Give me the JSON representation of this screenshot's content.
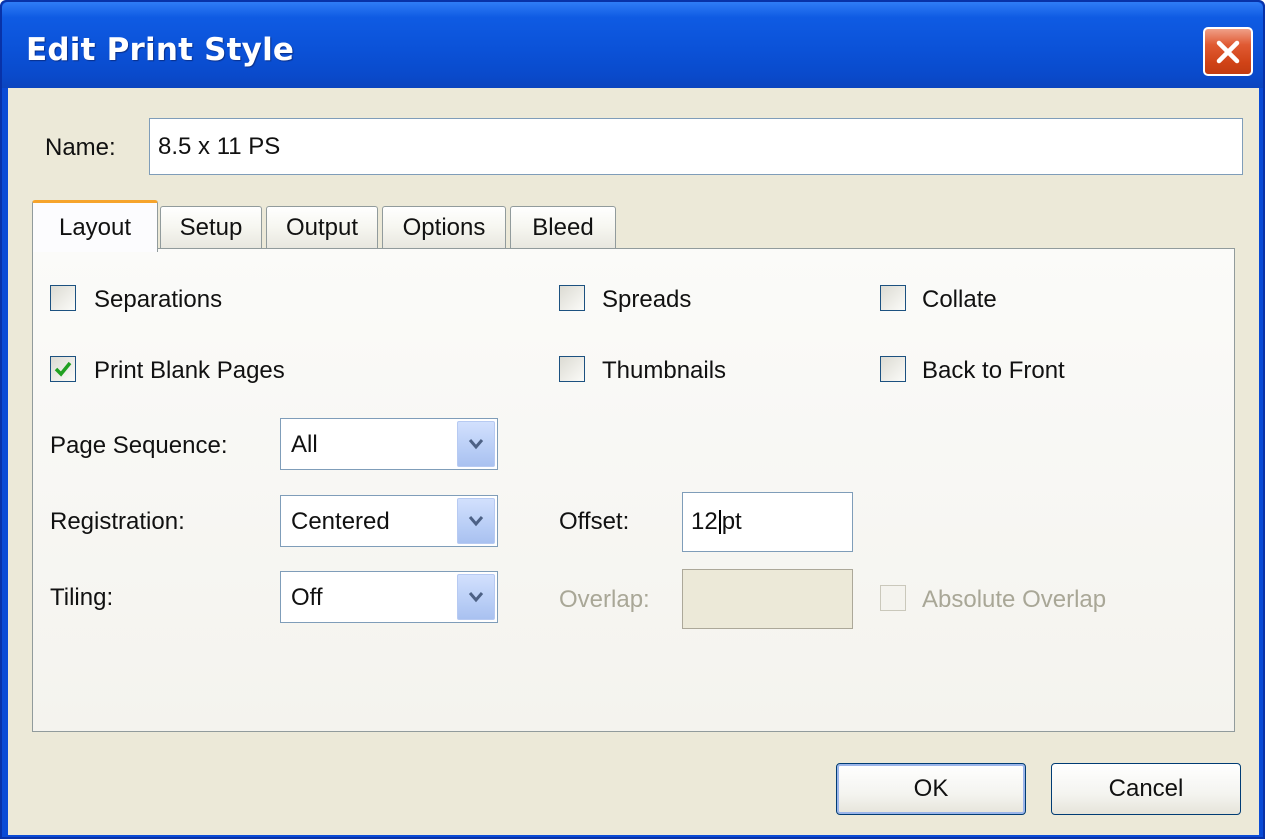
{
  "window": {
    "title": "Edit Print Style"
  },
  "name_field": {
    "label": "Name:",
    "value": "8.5 x 11 PS"
  },
  "tabs": [
    {
      "label": "Layout",
      "active": true
    },
    {
      "label": "Setup",
      "active": false
    },
    {
      "label": "Output",
      "active": false
    },
    {
      "label": "Options",
      "active": false
    },
    {
      "label": "Bleed",
      "active": false
    }
  ],
  "checkboxes": {
    "separations": {
      "label": "Separations",
      "checked": false
    },
    "spreads": {
      "label": "Spreads",
      "checked": false
    },
    "collate": {
      "label": "Collate",
      "checked": false
    },
    "print_blank_pages": {
      "label": "Print Blank Pages",
      "checked": true
    },
    "thumbnails": {
      "label": "Thumbnails",
      "checked": false
    },
    "back_to_front": {
      "label": "Back to Front",
      "checked": false
    },
    "absolute_overlap": {
      "label": "Absolute Overlap",
      "checked": false,
      "disabled": true
    }
  },
  "page_sequence": {
    "label": "Page Sequence:",
    "value": "All"
  },
  "registration": {
    "label": "Registration:",
    "value": "Centered"
  },
  "tiling": {
    "label": "Tiling:",
    "value": "Off"
  },
  "offset": {
    "label": "Offset:",
    "value_before_caret": "12",
    "value_after_caret": "pt"
  },
  "overlap": {
    "label": "Overlap:",
    "value": "",
    "disabled": true
  },
  "buttons": {
    "ok": "OK",
    "cancel": "Cancel"
  },
  "colors": {
    "titlebar": "#0b52d8",
    "dialog_face": "#ece9d8",
    "tab_highlight": "#f6a42c",
    "checkmark": "#21a121",
    "close_button": "#d04317"
  },
  "icons": {
    "close": "close-x-icon",
    "dropdown": "chevron-down-icon",
    "check": "checkmark-icon"
  }
}
